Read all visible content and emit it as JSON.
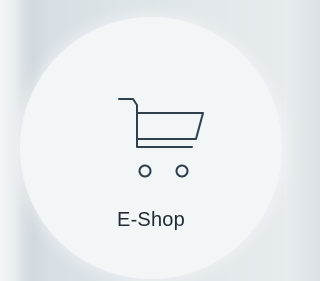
{
  "tile": {
    "label": "E-Shop",
    "icon": "shopping-cart-icon"
  },
  "colors": {
    "tile_background": "#f3f6f7",
    "icon_stroke": "#2f3f4c",
    "label_text": "#1f2a33"
  }
}
